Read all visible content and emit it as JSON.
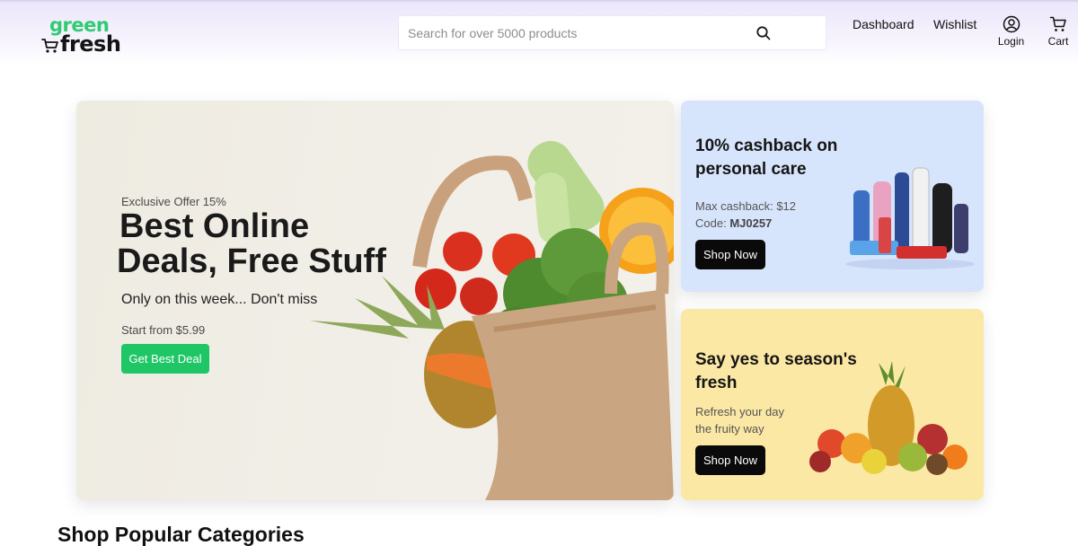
{
  "header": {
    "logo": {
      "line1": "green",
      "line2": "fresh"
    },
    "search": {
      "placeholder": "Search for over 5000 products",
      "value": ""
    },
    "nav": {
      "dashboard": "Dashboard",
      "wishlist": "Wishlist",
      "login": "Login",
      "cart": "Cart"
    }
  },
  "hero": {
    "eyebrow": "Exclusive Offer 15%",
    "title_line1": "Best Online",
    "title_line2": "Deals, Free Stuff",
    "subtitle": "Only on this week... Don't miss",
    "price": "Start from $5.99",
    "button": "Get Best Deal"
  },
  "promos": [
    {
      "title": "10% cashback on personal care",
      "line1": "Max cashback: $12",
      "code_label": "Code: ",
      "code": "MJ0257",
      "button": "Shop Now"
    },
    {
      "title": "Say yes to season's fresh",
      "line1": "Refresh your day",
      "line2": "the fruity way",
      "button": "Shop Now"
    }
  ],
  "section": {
    "title": "Shop Popular Categories"
  },
  "colors": {
    "brand_green": "#1fc665",
    "header_tint": "#ece6fb",
    "promo_blue": "#d7e5fc",
    "promo_yellow": "#fce8a5",
    "button_dark": "#0a0a0a"
  },
  "icons": [
    "cart-logo-icon",
    "search-icon",
    "user-icon",
    "cart-icon"
  ]
}
